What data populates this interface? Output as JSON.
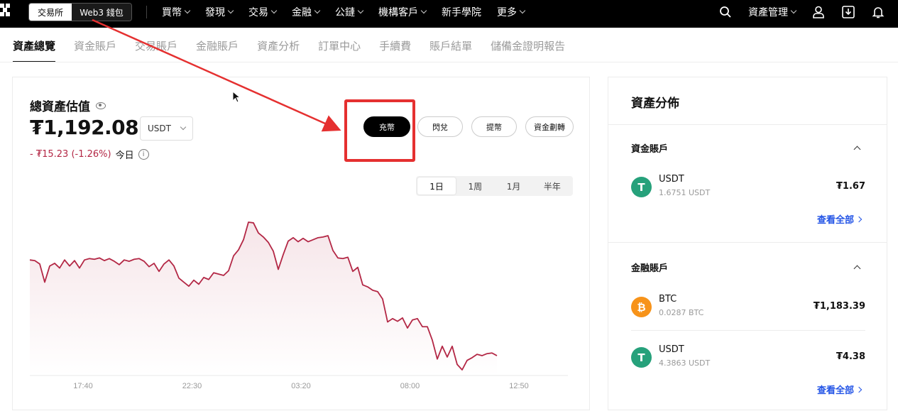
{
  "header": {
    "switch": {
      "exchange": "交易所",
      "wallet": "Web3 錢包"
    },
    "nav": [
      "買幣",
      "發現",
      "交易",
      "金融",
      "公鏈",
      "機構客戶",
      "新手學院",
      "更多"
    ],
    "asset_manage": "資產管理"
  },
  "tabs": [
    "資產總覽",
    "資金賬戶",
    "交易賬戶",
    "金融賬戶",
    "資產分析",
    "訂單中心",
    "手續費",
    "賬戶結單",
    "儲備金證明報告"
  ],
  "overview": {
    "title": "總資產估值",
    "balance": "₮1,192.08",
    "unit": "USDT",
    "change": "- ₮15.23 (-1.26%)",
    "change_label": "今日",
    "info_icon": "i",
    "actions": [
      "充幣",
      "閃兌",
      "提幣",
      "資金劃轉"
    ],
    "ranges": [
      "1日",
      "1周",
      "1月",
      "半年"
    ],
    "active_range": "1日"
  },
  "chart_data": {
    "type": "area",
    "x_tick_labels": [
      "17:40",
      "22:30",
      "03:20",
      "08:00",
      "12:50"
    ],
    "y_values": [
      1199.5,
      1199.4,
      1198.9,
      1196.2,
      1198.6,
      1199.0,
      1198.3,
      1199.5,
      1198.6,
      1199.4,
      1198.3,
      1199.5,
      1199.7,
      1199.6,
      1199.8,
      1199.4,
      1199.7,
      1199.3,
      1198.8,
      1199.5,
      1199.3,
      1199.6,
      1199.7,
      1199.3,
      1198.5,
      1199.0,
      1197.8,
      1198.9,
      1199.5,
      1198.6,
      1196.8,
      1196.2,
      1195.6,
      1196.5,
      1195.9,
      1196.9,
      1196.6,
      1197.6,
      1197.4,
      1197.2,
      1197.9,
      1200.1,
      1201.0,
      1202.5,
      1205.1,
      1205.0,
      1203.5,
      1202.9,
      1202.1,
      1200.8,
      1198.1,
      1200.3,
      1202.3,
      1202.8,
      1202.2,
      1202.7,
      1202.2,
      1202.5,
      1202.8,
      1202.9,
      1203.1,
      1200.9,
      1199.8,
      1199.7,
      1199.9,
      1197.8,
      1198.4,
      1195.8,
      1195.5,
      1195.0,
      1194.8,
      1193.7,
      1190.3,
      1190.8,
      1190.4,
      1190.9,
      1189.4,
      1190.6,
      1190.8,
      1189.6,
      1189.6,
      1187.6,
      1184.8,
      1186.7,
      1185.1,
      1186.7,
      1184.0,
      1183.2,
      1184.6,
      1185.0,
      1185.5,
      1185.3,
      1185.6,
      1185.7,
      1185.3
    ],
    "grid": false,
    "legend": "none"
  },
  "distribution": {
    "title": "資產分佈",
    "funding": {
      "title": "資金賬戶",
      "assets": [
        {
          "name": "USDT",
          "sub": "1.6751 USDT",
          "value": "₮1.67"
        }
      ],
      "view_all": "查看全部"
    },
    "earn": {
      "title": "金融賬戶",
      "assets": [
        {
          "name": "BTC",
          "sub": "0.0287 BTC",
          "value": "₮1,183.39"
        },
        {
          "name": "USDT",
          "sub": "4.3863 USDT",
          "value": "₮4.38"
        }
      ],
      "view_all": "查看全部"
    }
  },
  "colors": {
    "accent": "#000000",
    "negative": "#b32745",
    "link": "#2354e6",
    "annotation": "#e53030",
    "usdt": "#26a17b",
    "btc": "#f7931a"
  }
}
